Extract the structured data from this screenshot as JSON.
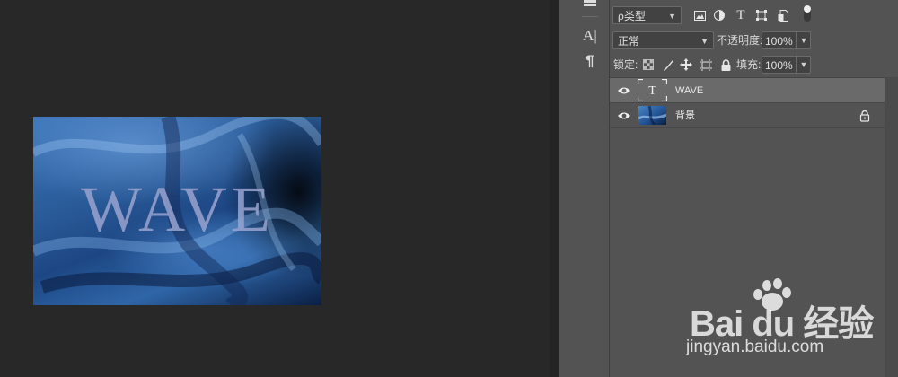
{
  "canvas": {
    "document_text": "WAVE"
  },
  "tools": {
    "items": [
      {
        "name": "character-panel-icon",
        "glyph": "A|"
      },
      {
        "name": "paragraph-panel-icon",
        "glyph": "¶"
      }
    ]
  },
  "layers_panel": {
    "filter": {
      "label": "ρ类型"
    },
    "filter_icons": [
      "image-filter-icon",
      "adjustment-filter-icon",
      "type-filter-icon",
      "shape-filter-icon",
      "smart-object-filter-icon",
      "filter-toggle-icon"
    ],
    "blend_mode": "正常",
    "opacity_label": "不透明度:",
    "opacity_value": "100%",
    "lock_label": "锁定:",
    "lock_icons": [
      "lock-transparent-icon",
      "lock-image-icon",
      "lock-position-icon",
      "lock-artboard-icon",
      "lock-all-icon"
    ],
    "fill_label": "填充:",
    "fill_value": "100%",
    "layers": [
      {
        "name": "WAVE",
        "kind": "text",
        "visible": true,
        "selected": true,
        "locked": false
      },
      {
        "name": "背景",
        "kind": "image",
        "visible": true,
        "selected": false,
        "locked": true
      }
    ]
  },
  "watermark": {
    "logo": "Bai du 经验",
    "url": "jingyan.baidu.com"
  }
}
